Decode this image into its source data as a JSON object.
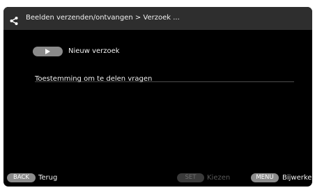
{
  "header": {
    "icon": "share-icon",
    "title": "Beelden verzenden/ontvangen > Verzoek ..."
  },
  "main": {
    "new_request": {
      "icon": "play-icon",
      "label": "Nieuw verzoek"
    },
    "permission_label": "Toestemming om te delen vragen"
  },
  "footer": {
    "back_key": "BACK",
    "back_label": "Terug",
    "set_key": "SET",
    "set_label": "Kiezen",
    "menu_key": "MENU",
    "menu_label": "Bijwerken"
  },
  "colors": {
    "background": "#000000",
    "header_bar": "#2e2e2e",
    "key_pill": "#8c8c8c",
    "disabled_key": "#3a3a3a",
    "disabled_text": "#5a5a5a"
  }
}
